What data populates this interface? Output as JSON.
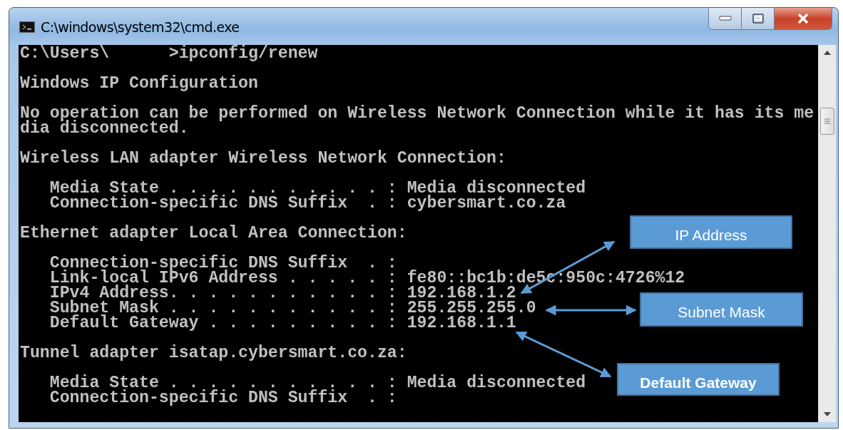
{
  "window": {
    "title": "C:\\windows\\system32\\cmd.exe"
  },
  "console": {
    "blocks": [
      {
        "lines": [
          "C:\\Users\\      >ipconfig/renew"
        ]
      },
      {
        "lines": [
          "Windows IP Configuration"
        ]
      },
      {
        "lines": [
          "No operation can be performed on Wireless Network Connection while it has its me",
          "dia disconnected."
        ]
      },
      {
        "lines": [
          "Wireless LAN adapter Wireless Network Connection:"
        ]
      },
      {
        "lines": [
          "   Media State . . . . . . . . . . . : Media disconnected",
          "   Connection-specific DNS Suffix  . : cybersmart.co.za"
        ]
      },
      {
        "lines": [
          "Ethernet adapter Local Area Connection:"
        ]
      },
      {
        "lines": [
          "   Connection-specific DNS Suffix  . :",
          "   Link-local IPv6 Address . . . . . : fe80::bc1b:de5c:950c:4726%12",
          "   IPv4 Address. . . . . . . . . . . : 192.168.1.2",
          "   Subnet Mask . . . . . . . . . . . : 255.255.255.0",
          "   Default Gateway . . . . . . . . . : 192.168.1.1"
        ]
      },
      {
        "lines": [
          "Tunnel adapter isatap.cybersmart.co.za:"
        ]
      },
      {
        "lines": [
          "   Media State . . . . . . . . . . . : Media disconnected",
          "   Connection-specific DNS Suffix  . :"
        ]
      }
    ]
  },
  "callouts": [
    {
      "label": "IP Address",
      "bold": false
    },
    {
      "label": "Subnet Mask",
      "bold": false
    },
    {
      "label": "Default Gateway",
      "bold": true
    }
  ]
}
